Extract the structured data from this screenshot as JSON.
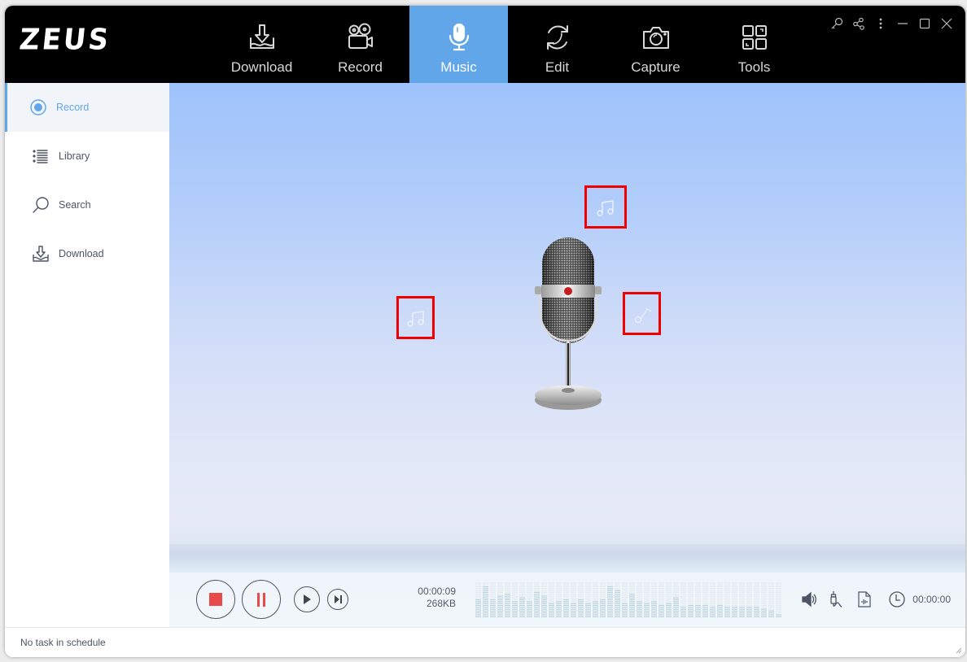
{
  "app": {
    "logo": "ZEUS"
  },
  "nav": {
    "items": [
      {
        "label": "Download",
        "icon": "download-tray-icon",
        "active": false
      },
      {
        "label": "Record",
        "icon": "video-camera-icon",
        "active": false
      },
      {
        "label": "Music",
        "icon": "microphone-icon",
        "active": true
      },
      {
        "label": "Edit",
        "icon": "refresh-cycle-icon",
        "active": false
      },
      {
        "label": "Capture",
        "icon": "camera-icon",
        "active": false
      },
      {
        "label": "Tools",
        "icon": "tools-grid-icon",
        "active": false
      }
    ],
    "active_color": "#62a6ea"
  },
  "window_controls": [
    "key-icon",
    "share-icon",
    "more-vertical-icon",
    "minimize-icon",
    "maximize-icon",
    "close-icon"
  ],
  "sidebar": {
    "items": [
      {
        "label": "Record",
        "icon": "radio-record-icon",
        "active": true
      },
      {
        "label": "Library",
        "icon": "list-icon",
        "active": false
      },
      {
        "label": "Search",
        "icon": "search-icon",
        "active": false
      },
      {
        "label": "Download",
        "icon": "download-icon",
        "active": false
      }
    ]
  },
  "main": {
    "illustration": "microphone-illustration",
    "highlighted_notes": [
      "double-music-note-icon",
      "double-music-note-icon",
      "single-music-note-icon"
    ],
    "highlight_color": "#f00000"
  },
  "controls": {
    "buttons": [
      "stop",
      "pause",
      "play",
      "skip-next"
    ],
    "elapsed_time": "00:00:09",
    "file_size": "268KB",
    "equalizer_levels": [
      0.55,
      0.9,
      0.5,
      0.65,
      0.7,
      0.45,
      0.6,
      0.45,
      0.75,
      0.65,
      0.4,
      0.45,
      0.5,
      0.4,
      0.55,
      0.4,
      0.45,
      0.55,
      0.9,
      0.8,
      0.4,
      0.7,
      0.45,
      0.4,
      0.45,
      0.35,
      0.4,
      0.6,
      0.3,
      0.35,
      0.35,
      0.35,
      0.3,
      0.35,
      0.3,
      0.3,
      0.3,
      0.3,
      0.3,
      0.25,
      0.2,
      0.1
    ],
    "timer": "00:00:00",
    "tool_icons": [
      "speaker-icon",
      "audio-jack-icon",
      "audio-file-icon",
      "clock-icon"
    ],
    "accent_red": "#e84a4a"
  },
  "status": {
    "text": "No task in schedule"
  }
}
